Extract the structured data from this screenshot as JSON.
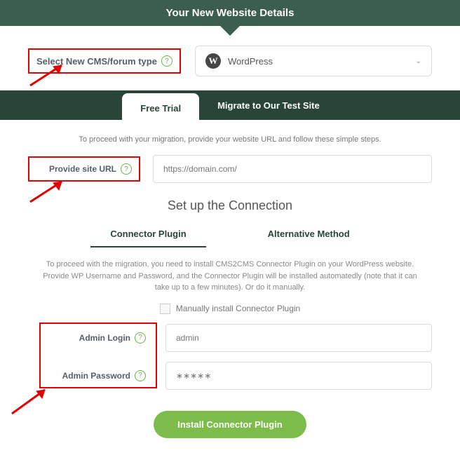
{
  "header": {
    "title": "Your New Website Details"
  },
  "cms": {
    "label": "Select New CMS/forum type",
    "selected": "WordPress"
  },
  "tabs": {
    "active": "Free Trial",
    "inactive": "Migrate to Our Test Site"
  },
  "intro": "To proceed with your migration, provide your website URL and follow these simple steps.",
  "url": {
    "label": "Provide site URL",
    "placeholder": "https://domain.com/"
  },
  "section_title": "Set up the Connection",
  "subtabs": {
    "active": "Connector Plugin",
    "inactive": "Alternative Method"
  },
  "instructions": "To proceed with the migration, you need to install CMS2CMS Connector Plugin on your WordPress website. Provide WP Username and Password, and the Connector Plugin will be installed automatedly (note that it can take up to a few minutes). Or do it manually.",
  "manual_checkbox": "Manually install Connector Plugin",
  "admin": {
    "login_label": "Admin Login",
    "login_placeholder": "admin",
    "password_label": "Admin Password",
    "password_placeholder": "∗∗∗∗∗"
  },
  "install_btn": "Install Connector Plugin"
}
